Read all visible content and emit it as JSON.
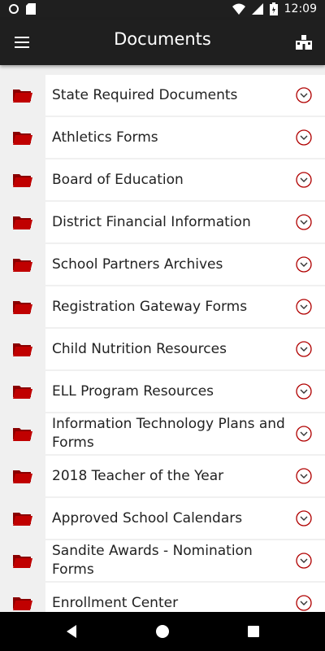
{
  "status_bar": {
    "time": "12:09",
    "icons": [
      "record-icon",
      "sd-card-icon",
      "wifi-icon",
      "signal-icon",
      "battery-icon"
    ]
  },
  "app_bar": {
    "title": "Documents",
    "menu_icon": "menu-icon",
    "right_icon": "school-icon"
  },
  "folders": [
    {
      "label": "State Required Documents"
    },
    {
      "label": "Athletics Forms"
    },
    {
      "label": "Board of Education"
    },
    {
      "label": "District Financial Information"
    },
    {
      "label": "School Partners Archives"
    },
    {
      "label": "Registration Gateway Forms"
    },
    {
      "label": "Child Nutrition Resources"
    },
    {
      "label": "ELL Program Resources"
    },
    {
      "label": "Information Technology Plans and Forms"
    },
    {
      "label": "2018 Teacher of the Year"
    },
    {
      "label": "Approved School Calendars"
    },
    {
      "label": "Sandite Awards - Nomination Forms"
    },
    {
      "label": "Enrollment Center"
    }
  ],
  "colors": {
    "bar": "#1f1f1f",
    "accent": "#b00000",
    "background": "#f0f0f0",
    "card": "#ffffff"
  },
  "nav_bar": {
    "buttons": [
      "back-icon",
      "home-icon",
      "recents-icon"
    ]
  }
}
